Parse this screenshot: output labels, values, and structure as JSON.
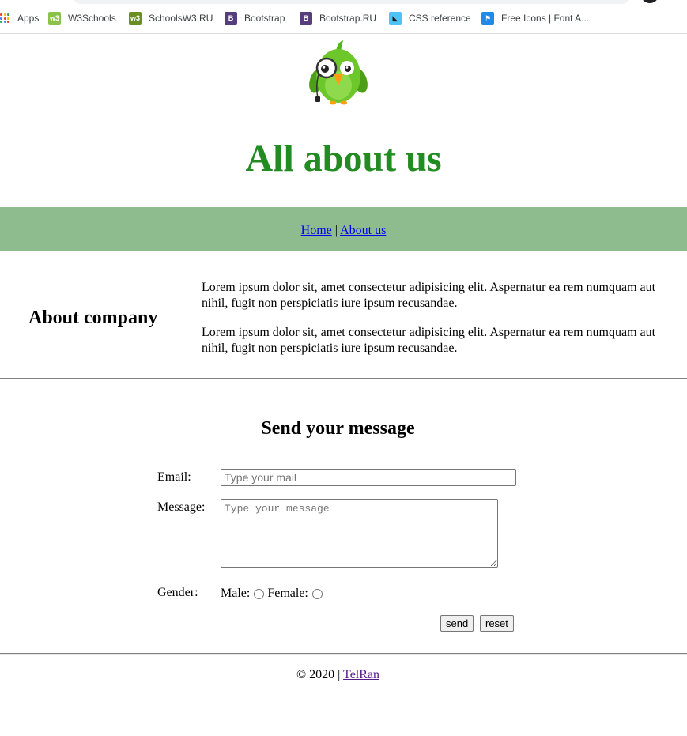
{
  "bookmarks": [
    {
      "label": "Apps",
      "icon": "apps-grid-icon"
    },
    {
      "label": "W3Schools",
      "icon": "w3schools-icon",
      "color": "#8bc34a",
      "glyph": "w3"
    },
    {
      "label": "SchoolsW3.RU",
      "icon": "schoolsw3-icon",
      "color": "#6b8e23",
      "glyph": "w3"
    },
    {
      "label": "Bootstrap",
      "icon": "bootstrap-icon",
      "color": "#563d7c",
      "glyph": "B"
    },
    {
      "label": "Bootstrap.RU",
      "icon": "bootstrap-icon",
      "color": "#563d7c",
      "glyph": "B"
    },
    {
      "label": "CSS reference",
      "icon": "css-reference-icon",
      "color": "#4fc3f7",
      "glyph": "◣"
    },
    {
      "label": "Free Icons | Font A...",
      "icon": "font-awesome-flag-icon",
      "color": "#228ae6",
      "glyph": "⚑"
    }
  ],
  "header": {
    "logo": "owl-with-monocle-logo",
    "title": "All about us"
  },
  "nav": {
    "home": "Home",
    "separator": "|",
    "about": "About us"
  },
  "about": {
    "heading": "About company",
    "paragraphs": [
      "Lorem ipsum dolor sit, amet consectetur adipisicing elit. Aspernatur ea rem numquam aut nihil, fugit non perspiciatis iure ipsum recusandae.",
      "Lorem ipsum dolor sit, amet consectetur adipisicing elit. Aspernatur ea rem numquam aut nihil, fugit non perspiciatis iure ipsum recusandae."
    ]
  },
  "form": {
    "heading": "Send your message",
    "email_label": "Email:",
    "email_placeholder": "Type your mail",
    "message_label": "Message:",
    "message_placeholder": "Type your message",
    "gender_label": "Gender:",
    "male_label": "Male:",
    "female_label": "Female:",
    "send_label": "send",
    "reset_label": "reset"
  },
  "footer": {
    "copyright": "© 2020",
    "separator": "|",
    "link": "TelRan"
  },
  "colors": {
    "title_green": "#228b22",
    "nav_background": "#8fbc8f",
    "link_blue": "#0000ee",
    "visited_link": "#551a8b"
  }
}
